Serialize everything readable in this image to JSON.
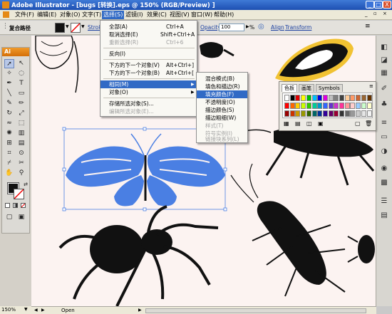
{
  "window": {
    "title": "Adobe Illustrator - [bugs [转换].eps @ 150% (RGB/Preview) ]",
    "buttons": [
      "_",
      "□",
      "X"
    ]
  },
  "menubar": [
    {
      "label": "文件(F)"
    },
    {
      "label": "编辑(E)"
    },
    {
      "label": "对象(O)"
    },
    {
      "label": "文字(T)"
    },
    {
      "label": "选择(S)",
      "active": true
    },
    {
      "label": "滤镜(I)"
    },
    {
      "label": "效果(C)"
    },
    {
      "label": "视图(V)"
    },
    {
      "label": "窗口(W)"
    },
    {
      "label": "帮助(H)"
    }
  ],
  "controlbar": {
    "path_label": "复合路径",
    "stroke_label": "Stroke",
    "opacity_label": "Opacity:",
    "opacity_value": "100",
    "opacity_unit": "%",
    "align_label": "Align",
    "transform_label": "Transform"
  },
  "select_menu": {
    "items": [
      {
        "label": "全部(A)",
        "shortcut": "Ctrl+A",
        "state": "normal"
      },
      {
        "label": "取消选择(E)",
        "shortcut": "Shift+Ctrl+A",
        "state": "normal"
      },
      {
        "label": "重新选择(R)",
        "shortcut": "Ctrl+6",
        "state": "disabled"
      },
      {
        "sep": true
      },
      {
        "label": "反向(I)",
        "shortcut": "",
        "state": "normal"
      },
      {
        "sep": true
      },
      {
        "label": "下方的下一个对象(V)",
        "shortcut": "Alt+Ctrl+]",
        "state": "normal"
      },
      {
        "label": "下方的下一个对象(B)",
        "shortcut": "Alt+Ctrl+[",
        "state": "normal"
      },
      {
        "sep": true
      },
      {
        "label": "相同(M)",
        "shortcut": "",
        "state": "highlighted",
        "submenu": true
      },
      {
        "label": "对象(O)",
        "shortcut": "",
        "state": "normal",
        "submenu": true
      },
      {
        "sep": true
      },
      {
        "label": "存储所选对象(S)...",
        "shortcut": "",
        "state": "normal"
      },
      {
        "label": "编辑所选对象(E)...",
        "shortcut": "",
        "state": "disabled"
      }
    ]
  },
  "same_submenu": {
    "items": [
      {
        "label": "混合模式(B)",
        "state": "normal"
      },
      {
        "label": "填色和描边(R)",
        "state": "normal"
      },
      {
        "label": "填充颜色(F)",
        "state": "highlighted"
      },
      {
        "label": "不透明度(O)",
        "state": "normal"
      },
      {
        "label": "描边颜色(S)",
        "state": "normal"
      },
      {
        "label": "描边粗细(W)",
        "state": "normal"
      },
      {
        "label": "样式(T)",
        "state": "disabled"
      },
      {
        "label": "符号实例(I)",
        "state": "disabled"
      },
      {
        "label": "链接块系列(L)",
        "state": "disabled"
      }
    ]
  },
  "color_panel": {
    "tabs": [
      "色板",
      "画笔",
      "Symbols"
    ],
    "active_tab": "色板"
  },
  "tools": {
    "header": "Ai"
  },
  "status": {
    "zoom": "150%",
    "info": "Open"
  },
  "colors": {
    "selection_blue": "#4a7fe3",
    "titlebar": "#2a5fc4",
    "menu_highlight": "#316ac5",
    "artboard": "#fcf3f1",
    "ai_orange": "#e58a16"
  }
}
